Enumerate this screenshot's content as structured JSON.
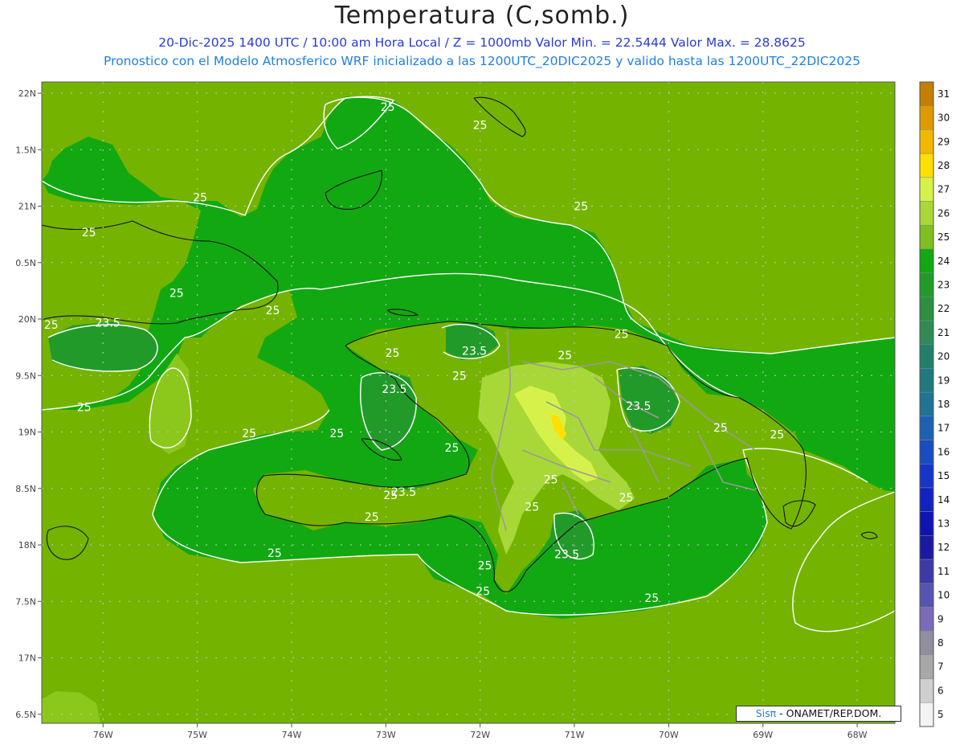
{
  "title": "Temperatura (C,somb.)",
  "subtitle1": "20-Dic-2025 1400 UTC / 10:00 am Hora Local / Z = 1000mb  Valor Min. = 22.5444  Valor Max. = 28.8625",
  "subtitle2": "Pronostico con el Modelo Atmosferico WRF inicializado a las 1200UTC_20DIC2025 y valido hasta las  1200UTC_22DIC2025",
  "credit_brand": "Sisπ",
  "credit_rest": " - ONAMET/REP.DOM.",
  "chart_data": {
    "type": "heatmap",
    "title": "Temperatura (C,somb.)",
    "variable": "Temperatura",
    "units": "C",
    "level": "1000mb",
    "valid_time": "20-Dic-2025 1400 UTC",
    "min_value": 22.5444,
    "max_value": 28.8625,
    "xlim": [
      -76.65,
      -67.6
    ],
    "ylim": [
      16.42,
      22.1
    ],
    "x_ticks": [
      -76,
      -75,
      -74,
      -73,
      -72,
      -71,
      -70,
      -69,
      -68
    ],
    "x_tick_labels": [
      "76W",
      "75W",
      "74W",
      "73W",
      "72W",
      "71W",
      "70W",
      "69W",
      "68W"
    ],
    "y_ticks": [
      22,
      21.5,
      21,
      20.5,
      20,
      19.5,
      19,
      18.5,
      18,
      17.5,
      17,
      16.5
    ],
    "y_tick_labels": [
      "22N",
      "1.5N",
      "21N",
      "0.5N",
      "20N",
      "9.5N",
      "19N",
      "8.5N",
      "18N",
      "7.5N",
      "17N",
      "6.5N"
    ],
    "grid": true,
    "colorbar": {
      "position": "right",
      "labels": [
        "31",
        "30",
        "29",
        "28",
        "27",
        "26",
        "25",
        "24",
        "23",
        "22",
        "21",
        "20",
        "19",
        "18",
        "17",
        "16",
        "15",
        "14",
        "13",
        "12",
        "11",
        "10",
        "9",
        "8",
        "7",
        "6",
        "5"
      ],
      "colors": [
        "#c47f00",
        "#e09a00",
        "#f2b800",
        "#ffe000",
        "#d6f24a",
        "#a8d838",
        "#7fbf1f",
        "#12a812",
        "#229a2a",
        "#2d8f3f",
        "#2f8a55",
        "#22806a",
        "#1e7a7f",
        "#1f7395",
        "#1c62b0",
        "#1a4cc2",
        "#1636c8",
        "#1222c0",
        "#0f14b0",
        "#1a1aa0",
        "#3a3aa8",
        "#5555b0",
        "#7a6ab8",
        "#8f8f9e",
        "#a8a8a8",
        "#cfcfcf",
        "#f4f4f4"
      ]
    },
    "contours": [
      {
        "value": 25,
        "labels": [
          [
            -72.98,
            21.88
          ],
          [
            -74.97,
            21.08
          ],
          [
            -72.0,
            21.72
          ],
          [
            -76.15,
            20.77
          ],
          [
            -74.2,
            20.08
          ],
          [
            -70.93,
            21.0
          ],
          [
            -75.22,
            20.23
          ],
          [
            -70.5,
            19.87
          ],
          [
            -72.93,
            19.7
          ],
          [
            -71.1,
            19.68
          ],
          [
            -72.22,
            19.5
          ],
          [
            -76.55,
            19.95
          ],
          [
            -76.2,
            19.22
          ],
          [
            -74.45,
            18.99
          ],
          [
            -73.52,
            18.99
          ],
          [
            -72.3,
            18.86
          ],
          [
            -72.95,
            18.44
          ],
          [
            -71.25,
            18.58
          ],
          [
            -71.45,
            18.34
          ],
          [
            -73.15,
            18.25
          ],
          [
            -70.45,
            18.42
          ],
          [
            -69.45,
            19.04
          ],
          [
            -68.85,
            18.98
          ],
          [
            -74.18,
            17.93
          ],
          [
            -71.97,
            17.59
          ],
          [
            -71.95,
            17.82
          ],
          [
            -70.18,
            17.53
          ]
        ]
      },
      {
        "value": 23.5,
        "labels": [
          [
            -75.95,
            19.97
          ],
          [
            -72.06,
            19.72
          ],
          [
            -72.91,
            19.38
          ],
          [
            -72.81,
            18.47
          ],
          [
            -70.32,
            19.23
          ],
          [
            -71.08,
            17.92
          ]
        ]
      }
    ]
  }
}
